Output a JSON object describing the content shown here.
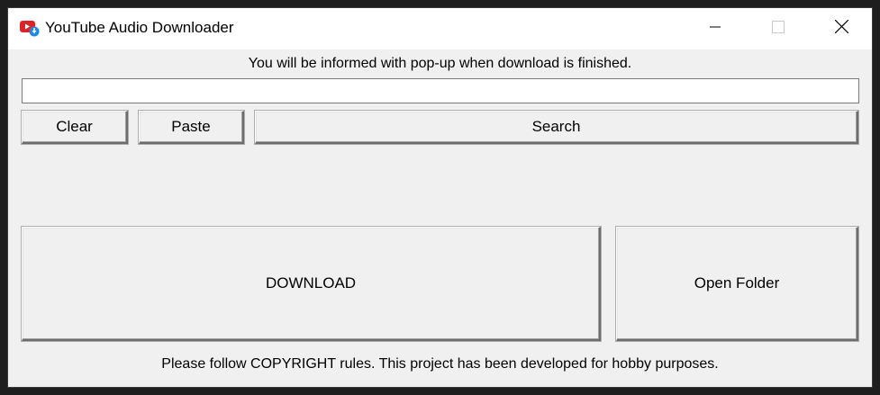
{
  "window": {
    "title": "YouTube Audio Downloader",
    "icon": "youtube-download-icon"
  },
  "titlebar": {
    "minimize_icon": "minimize-icon",
    "maximize_icon": "maximize-icon",
    "close_icon": "close-icon"
  },
  "info_text": "You will be informed with pop-up when download is finished.",
  "url_input": {
    "value": "",
    "placeholder": ""
  },
  "buttons": {
    "clear": "Clear",
    "paste": "Paste",
    "search": "Search",
    "download": "DOWNLOAD",
    "open_folder": "Open Folder"
  },
  "footer_text": "Please follow COPYRIGHT rules. This project has been developed for hobby purposes.",
  "colors": {
    "window_bg": "#f0f0f0",
    "titlebar_bg": "#ffffff",
    "icon_red": "#d9252a",
    "icon_blue": "#1e88e5"
  }
}
